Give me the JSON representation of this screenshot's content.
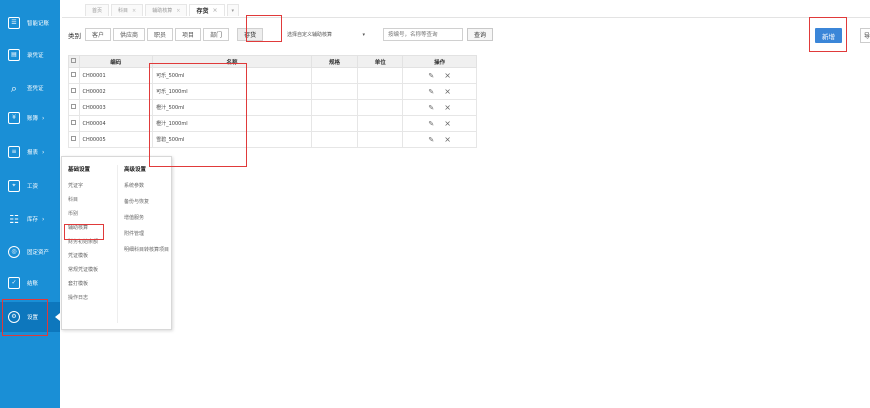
{
  "sidebar": {
    "items": [
      {
        "label": "智能记账",
        "icon": "☰",
        "arrow": ""
      },
      {
        "label": "录凭证",
        "icon": "▤",
        "arrow": ""
      },
      {
        "label": "查凭证",
        "icon": "⌕",
        "arrow": ""
      },
      {
        "label": "账簿",
        "icon": "¥",
        "arrow": "›"
      },
      {
        "label": "报表",
        "icon": "≡",
        "arrow": "›"
      },
      {
        "label": "工资",
        "icon": "⌖",
        "arrow": ""
      },
      {
        "label": "库存",
        "icon": "☷",
        "arrow": "›"
      },
      {
        "label": "固定资产",
        "icon": "◎",
        "arrow": ""
      },
      {
        "label": "结账",
        "icon": "✓",
        "arrow": ""
      },
      {
        "label": "设置",
        "icon": "⚙",
        "arrow": ""
      }
    ]
  },
  "tabs": [
    {
      "label": "首页",
      "close": ""
    },
    {
      "label": "科目",
      "close": "×"
    },
    {
      "label": "辅助核算",
      "close": "×"
    },
    {
      "label": "存货",
      "close": "×"
    },
    {
      "label": "▾",
      "close": ""
    }
  ],
  "filter": {
    "category_label": "类别",
    "chips": [
      "客户",
      "供应商",
      "职员",
      "项目",
      "部门",
      "存货"
    ],
    "selected_chip": "存货",
    "custom_select": "选择自定义辅助核算",
    "custom_select_arrow": "▾",
    "search_placeholder": "按编号，名称等查询",
    "query_label": "查询",
    "add_label": "新增",
    "more_label": "导"
  },
  "table": {
    "headers": [
      "编码",
      "名称",
      "规格",
      "单位",
      "操作"
    ],
    "rows": [
      {
        "code": "CH00001",
        "name": "可乐_500ml"
      },
      {
        "code": "CH00002",
        "name": "可乐_1000ml"
      },
      {
        "code": "CH00003",
        "name": "橙汁_500ml"
      },
      {
        "code": "CH00004",
        "name": "橙汁_1000ml"
      },
      {
        "code": "CH00005",
        "name": "雪碧_500ml"
      }
    ],
    "edit_icon": "✎",
    "delete_icon": "×"
  },
  "settings_menu": {
    "basic": {
      "title": "基础设置",
      "items": [
        "凭证字",
        "科目",
        "币别",
        "辅助核算",
        "财务初始余额",
        "凭证模板",
        "常规凭证模板",
        "套打模板",
        "操作日志"
      ]
    },
    "advanced": {
      "title": "高级设置",
      "items": [
        "系统参数",
        "备份与恢复",
        "增值服务",
        "附件管理",
        "明细科目转核算项目"
      ]
    }
  },
  "colors": {
    "sidebar": "#1a8fd6",
    "primary_button": "#3b86d8",
    "highlight": "#e03a3a"
  }
}
